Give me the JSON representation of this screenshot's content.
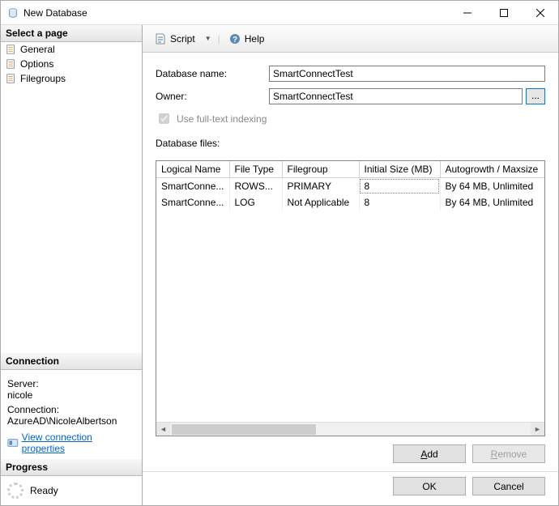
{
  "window": {
    "title": "New Database"
  },
  "left": {
    "pages_header": "Select a page",
    "pages": [
      "General",
      "Options",
      "Filegroups"
    ],
    "connection_header": "Connection",
    "server_label": "Server:",
    "server_value": "nicole",
    "connection_label": "Connection:",
    "connection_value": "AzureAD\\NicoleAlbertson",
    "view_props": "View connection properties",
    "progress_header": "Progress",
    "progress_status": "Ready"
  },
  "toolbar": {
    "script": "Script",
    "help": "Help"
  },
  "form": {
    "db_name_label": "Database name:",
    "db_name_value": "SmartConnectTest",
    "owner_label": "Owner:",
    "owner_value": "SmartConnectTest",
    "browse": "...",
    "ft_label": "Use full-text indexing",
    "files_label": "Database files:"
  },
  "grid": {
    "cols": [
      "Logical Name",
      "File Type",
      "Filegroup",
      "Initial Size (MB)",
      "Autogrowth / Maxsize"
    ],
    "rows": [
      {
        "logical": "SmartConne...",
        "ftype": "ROWS...",
        "fgroup": "PRIMARY",
        "size": "8",
        "growth": "By 64 MB, Unlimited",
        "size_selected": true
      },
      {
        "logical": "SmartConne...",
        "ftype": "LOG",
        "fgroup": "Not Applicable",
        "size": "8",
        "growth": "By 64 MB, Unlimited",
        "size_selected": false
      }
    ]
  },
  "buttons": {
    "add": "Add",
    "remove": "Remove",
    "ok": "OK",
    "cancel": "Cancel"
  }
}
